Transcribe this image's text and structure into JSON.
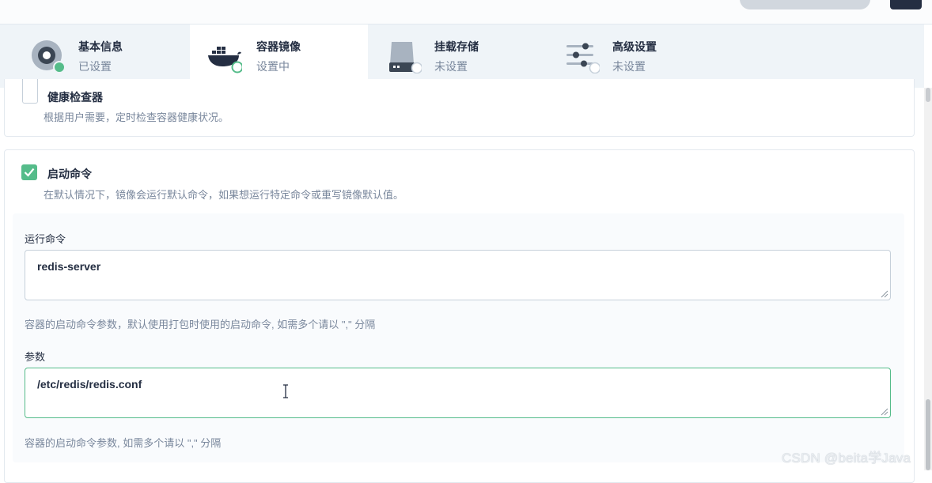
{
  "steps": [
    {
      "title": "基本信息",
      "status": "已设置",
      "icon": "disc-icon"
    },
    {
      "title": "容器镜像",
      "status": "设置中",
      "icon": "docker-whale-icon"
    },
    {
      "title": "挂载存储",
      "status": "未设置",
      "icon": "storage-drive-icon"
    },
    {
      "title": "高级设置",
      "status": "未设置",
      "icon": "sliders-icon"
    }
  ],
  "health": {
    "label": "健康检查器",
    "description": "根据用户需要，定时检查容器健康状况。"
  },
  "startup": {
    "label": "启动命令",
    "description": "在默认情况下，镜像会运行默认命令，如果想运行特定命令或重写镜像默认值。",
    "checked": true,
    "command": {
      "label": "运行命令",
      "value": "redis-server",
      "hint": "容器的启动命令参数，默认使用打包时使用的启动命令, 如需多个请以 \",\" 分隔"
    },
    "args": {
      "label": "参数",
      "value": "/etc/redis/redis.conf",
      "hint": "容器的启动命令参数, 如需多个请以 \",\" 分隔"
    }
  },
  "watermark": "CSDN @beita学Java",
  "colors": {
    "accent": "#55bc8a",
    "text": "#242e42",
    "muted": "#79879c"
  }
}
